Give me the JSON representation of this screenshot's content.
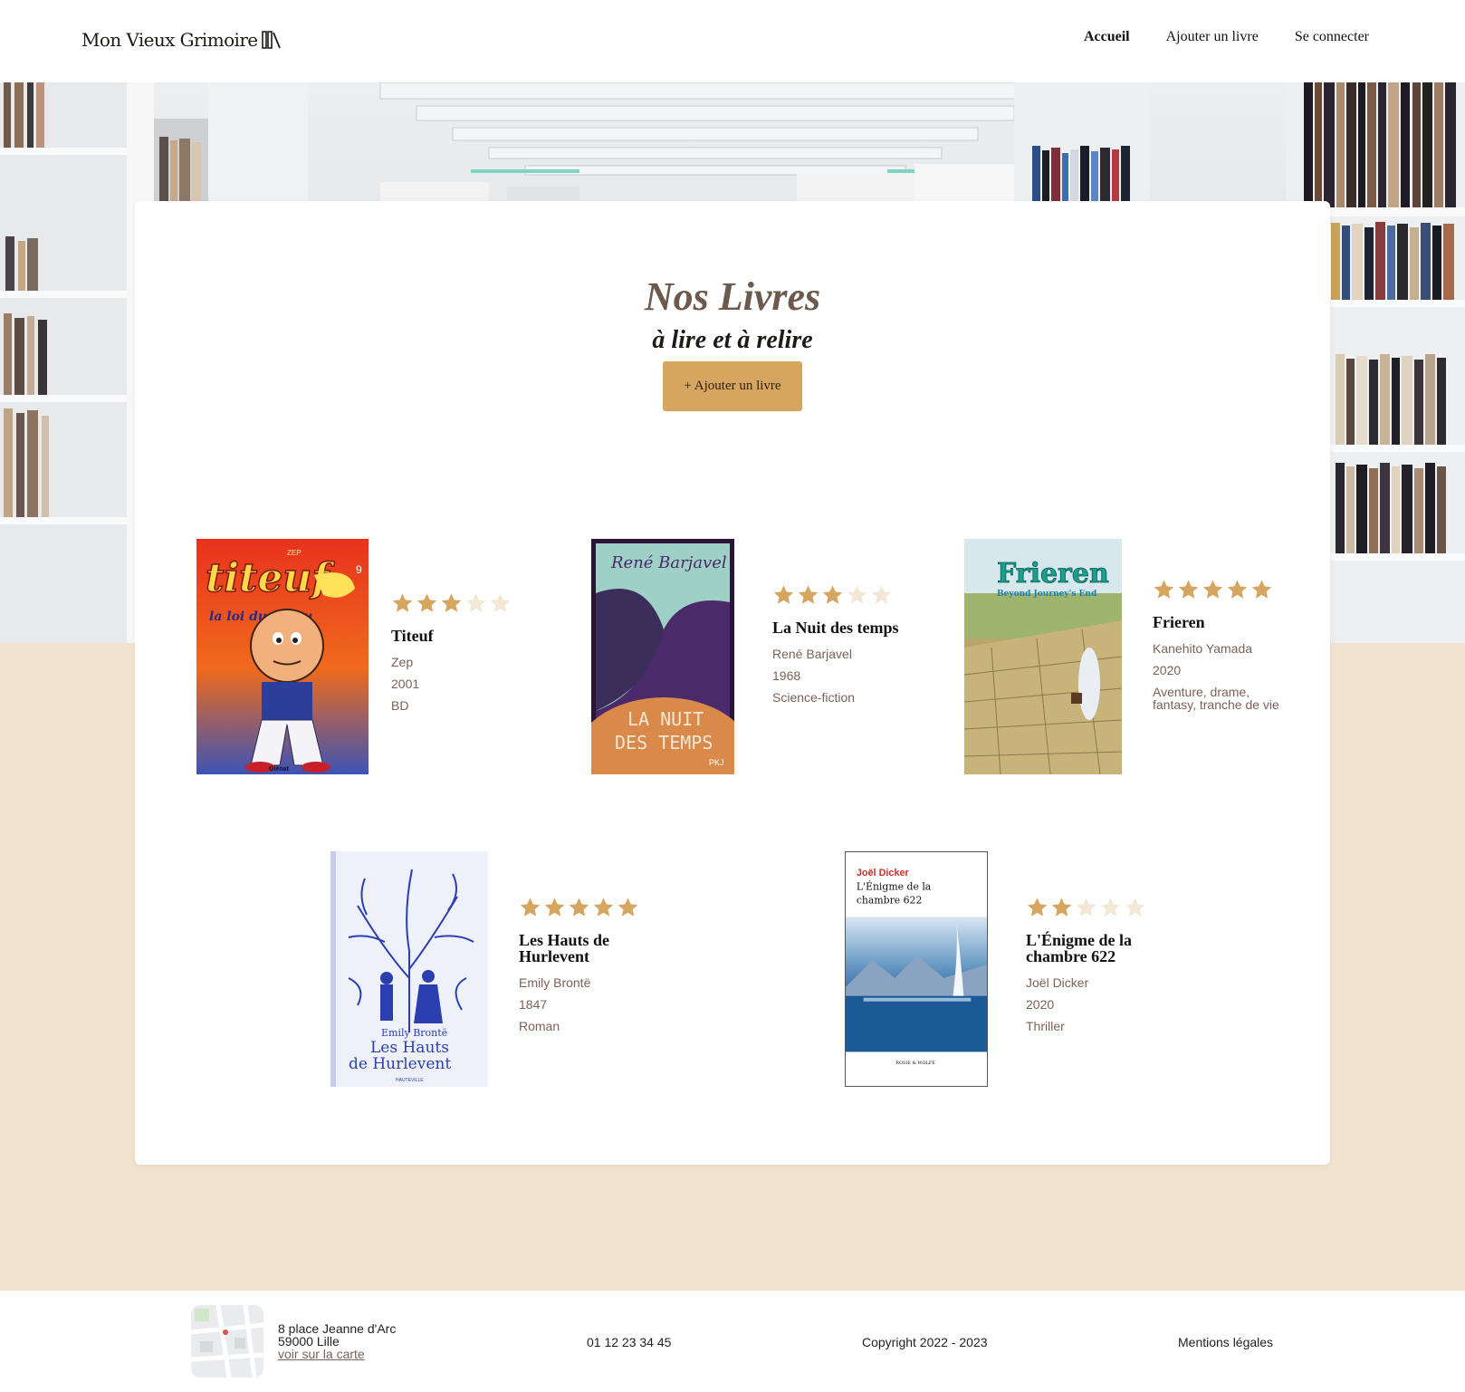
{
  "header": {
    "logo_text": "Mon Vieux Grimoire",
    "nav": [
      {
        "label": "Accueil",
        "active": true
      },
      {
        "label": "Ajouter un livre",
        "active": false
      },
      {
        "label": "Se connecter",
        "active": false
      }
    ]
  },
  "main": {
    "title": "Nos Livres",
    "subtitle": "à lire et à relire",
    "add_button": "+ Ajouter un livre"
  },
  "books": [
    {
      "title": "Titeuf",
      "author": "Zep",
      "year": "2001",
      "genre": "BD",
      "rating": 3,
      "cover_text": {
        "brand": "ZEP",
        "name": "titeuf",
        "tome": "9",
        "subtitle": "la loi du préau",
        "publisher": "Glénat"
      }
    },
    {
      "title": "La Nuit des temps",
      "author": "René Barjavel",
      "year": "1968",
      "genre": "Science-fiction",
      "rating": 3,
      "cover_text": {
        "author": "René Barjavel",
        "line1": "LA NUIT",
        "line2": "DES TEMPS",
        "publisher": "PKJ"
      }
    },
    {
      "title": "Frieren",
      "author": "Kanehito Yamada",
      "year": "2020",
      "genre": "Aventure, drame, fantasy, tranche de vie",
      "rating": 5,
      "cover_text": {
        "name": "Frieren",
        "subtitle": "Beyond Journey's End"
      }
    },
    {
      "title": "Les Hauts de Hurlevent",
      "author": "Emily Brontë",
      "year": "1847",
      "genre": "Roman",
      "rating": 5,
      "cover_text": {
        "author": "Emily Brontë",
        "line1": "Les Hauts",
        "line2": "de Hurlevent",
        "publisher": "HAUTEVILLE"
      }
    },
    {
      "title": "L'Énigme de la chambre 622",
      "author": "Joël Dicker",
      "year": "2020",
      "genre": "Thriller",
      "rating": 2,
      "cover_text": {
        "author": "Joël Dicker",
        "line1": "L'Énigme de la",
        "line2": "chambre 622",
        "publisher": "ROSIE & WOLFE"
      }
    }
  ],
  "footer": {
    "address_line1": "8 place Jeanne d'Arc",
    "address_line2": "59000 Lille",
    "map_link": "voir sur la carte",
    "phone": "01 12 23 34 45",
    "copyright": "Copyright 2022 - 2023",
    "legal": "Mentions légales"
  },
  "colors": {
    "accent": "#d6a661",
    "star_full": "#d6a661",
    "star_empty": "#f3e7d6",
    "page_bg": "#f1e3cf",
    "title": "#6d5a4f",
    "meta": "#7a6259"
  }
}
